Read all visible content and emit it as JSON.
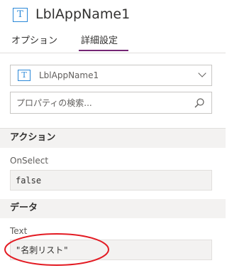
{
  "control": {
    "name": "LblAppName1",
    "icon": "label-icon"
  },
  "tabs": [
    {
      "label": "オプション",
      "active": false
    },
    {
      "label": "詳細設定",
      "active": true
    }
  ],
  "selector": {
    "value": "LblAppName1",
    "icon": "label-icon"
  },
  "search": {
    "placeholder": "プロパティの検索..."
  },
  "sections": {
    "action": {
      "title": "アクション",
      "properties": [
        {
          "name": "OnSelect",
          "value": "false"
        }
      ]
    },
    "data": {
      "title": "データ",
      "properties": [
        {
          "name": "Text",
          "value": "\"名刺リスト\""
        }
      ]
    }
  },
  "colors": {
    "accent": "#742774",
    "icon_blue": "#2b88d8",
    "annotation": "#e31b23"
  }
}
